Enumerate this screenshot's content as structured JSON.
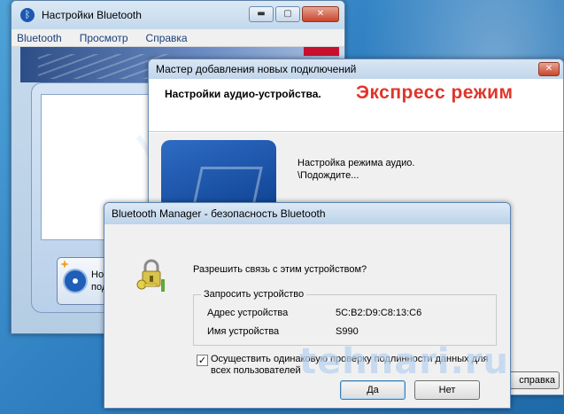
{
  "window_settings": {
    "title": "Настройки Bluetooth",
    "menu": [
      "Bluetooth",
      "Просмотр",
      "Справка"
    ],
    "new_connection_button": [
      "Ново",
      "подк"
    ],
    "controls": {
      "minimize": "▬",
      "maximize": "▢",
      "close": "✕"
    }
  },
  "window_wizard": {
    "title": "Мастер добавления новых подключений",
    "heading": "Настройки аудио-устройства.",
    "overlay_label": "Экспресс режим",
    "status_line1": "Настройка режима аудио.",
    "status_line2": "\\Подождите...",
    "help_button": "справка",
    "controls": {
      "close": "✕"
    }
  },
  "window_security": {
    "title": "Bluetooth Manager - безопасность Bluetooth",
    "question": "Разрешить связь с этим устройством?",
    "group_title": "Запросить устройство",
    "address_label": "Адрес устройства",
    "address_value": "5C:B2:D9:C8:13:C6",
    "name_label": "Имя устройства",
    "name_value": "S990",
    "checkbox_checked": true,
    "checkbox_mark": "✓",
    "checkbox_label": "Осуществить одинаковую проверку подлинности данных для всех пользователей",
    "yes_button": "Да",
    "no_button": "Нет"
  },
  "watermark": "tehnari.ru",
  "icons": [
    "bluetooth-icon",
    "lock-key-icon",
    "radio-waves-icon"
  ]
}
